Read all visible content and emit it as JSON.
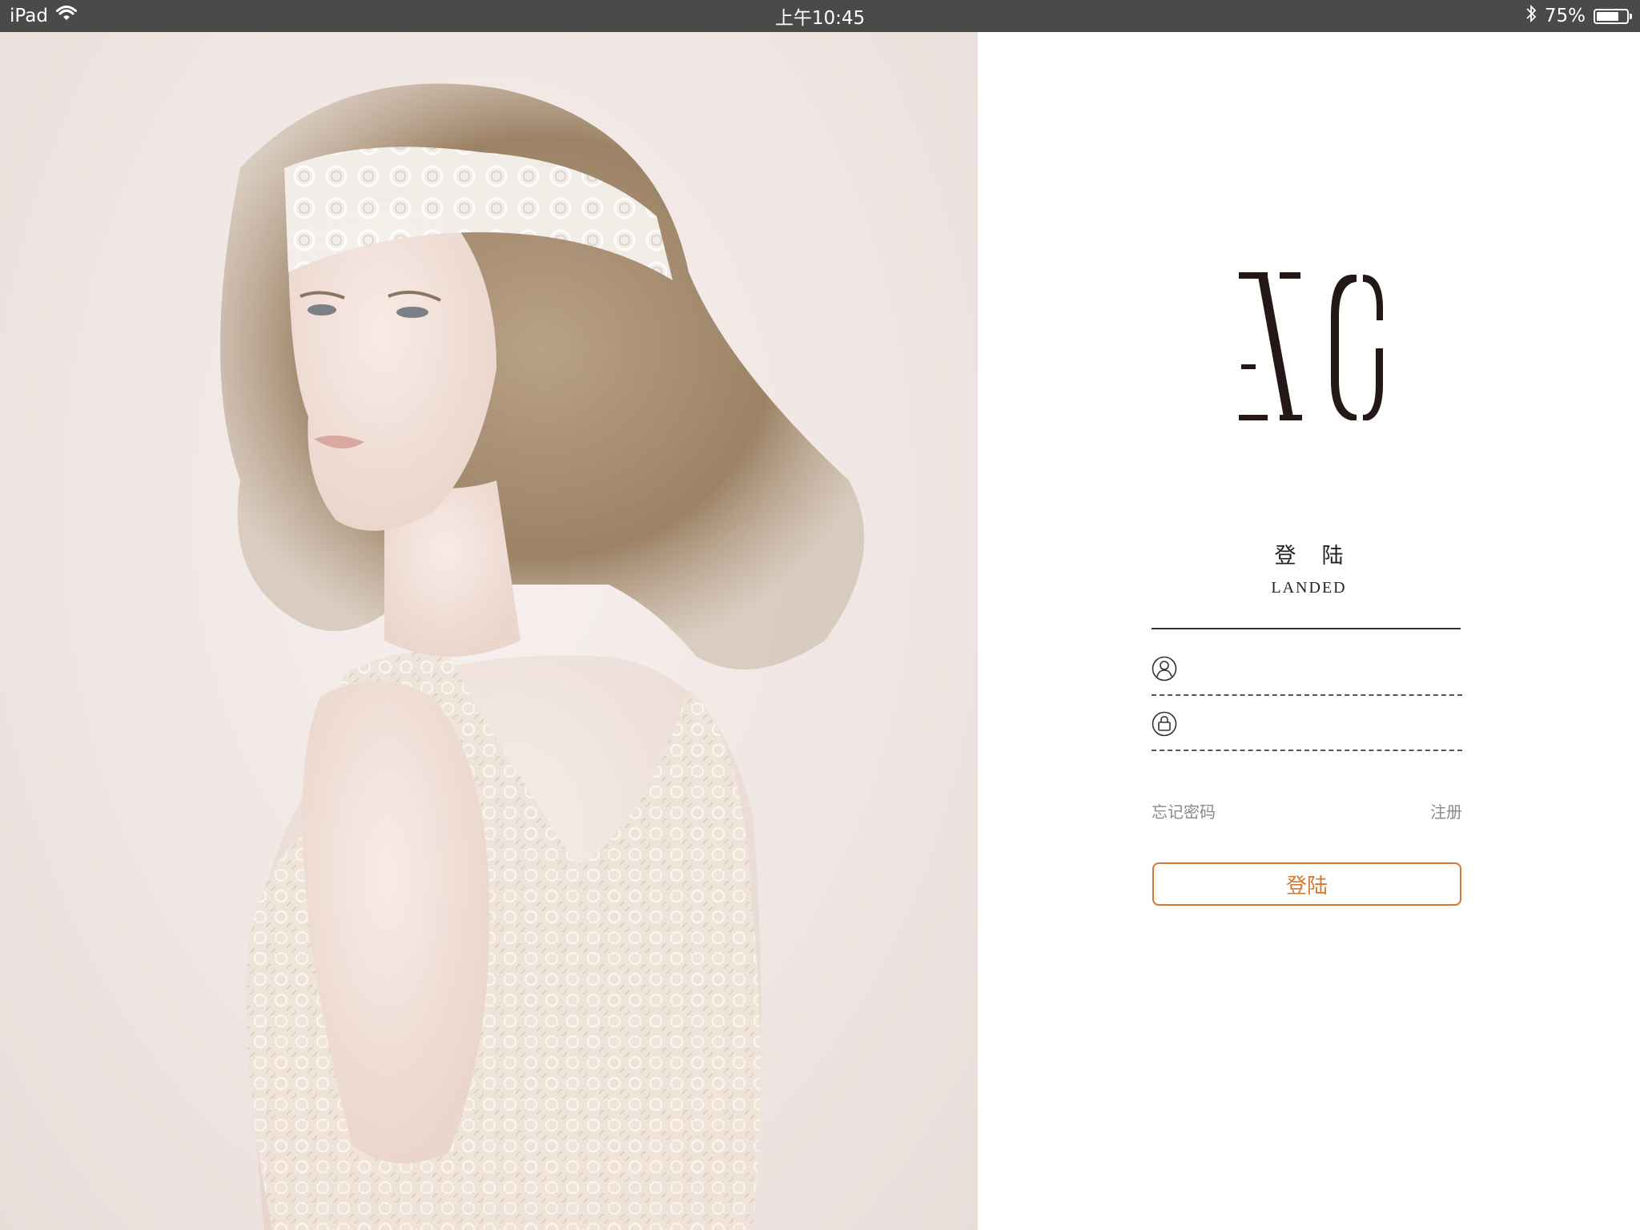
{
  "status_bar": {
    "device": "iPad",
    "time": "上午10:45",
    "battery_percent": "75%",
    "battery_level": 0.75,
    "icons": [
      "wifi-icon",
      "bluetooth-icon",
      "battery-icon"
    ]
  },
  "hero_image": {
    "icon": "model-portrait-photo"
  },
  "login": {
    "logo_icon": "xg-logo",
    "title_cn": "登陆",
    "title_en": "LANDED",
    "username": {
      "icon": "user-icon",
      "value": "",
      "placeholder": ""
    },
    "password": {
      "icon": "lock-icon",
      "value": "",
      "placeholder": ""
    },
    "forgot_password": "忘记密码",
    "register": "注册",
    "submit_label": "登陆"
  },
  "colors": {
    "status_bar": "#4a4a4a",
    "accent": "#d9772e",
    "link": "#8a8a8a",
    "text": "#222222"
  }
}
